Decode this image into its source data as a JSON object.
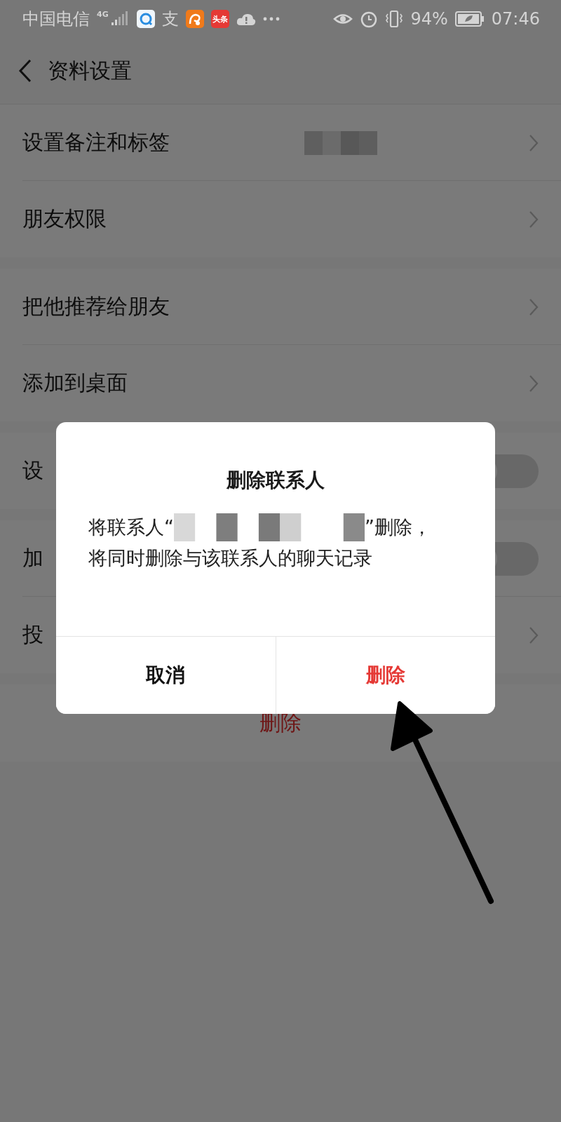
{
  "status_bar": {
    "carrier": "中国电信",
    "network": "4G",
    "app_icons": [
      {
        "kind": "browser"
      },
      {
        "kind": "alipay",
        "text": "支"
      },
      {
        "kind": "squirrel"
      },
      {
        "kind": "news",
        "text": "头条"
      },
      {
        "kind": "cloud"
      },
      {
        "kind": "more"
      }
    ],
    "battery_percent": "94%",
    "time": "07:46"
  },
  "header": {
    "title": "资料设置"
  },
  "sections": [
    {
      "items": [
        {
          "label": "设置备注和标签",
          "kind": "chevron",
          "redacted_value": true
        },
        {
          "label": "朋友权限",
          "kind": "chevron"
        }
      ]
    },
    {
      "items": [
        {
          "label": "把他推荐给朋友",
          "kind": "chevron"
        },
        {
          "label": "添加到桌面",
          "kind": "chevron"
        }
      ]
    },
    {
      "items": [
        {
          "label": "设",
          "kind": "toggle",
          "on": false
        }
      ]
    },
    {
      "items": [
        {
          "label": "加",
          "kind": "toggle",
          "on": false
        },
        {
          "label": "投",
          "kind": "chevron"
        }
      ]
    }
  ],
  "delete_button": "删除",
  "dialog": {
    "title": "删除联系人",
    "message_start": "将联系人“",
    "message_end": "”删除，",
    "message_line2": "将同时删除与该联系人的聊天记录",
    "buttons": [
      {
        "label": "取消",
        "kind": "cancel"
      },
      {
        "label": "删除",
        "kind": "destructive"
      }
    ]
  }
}
